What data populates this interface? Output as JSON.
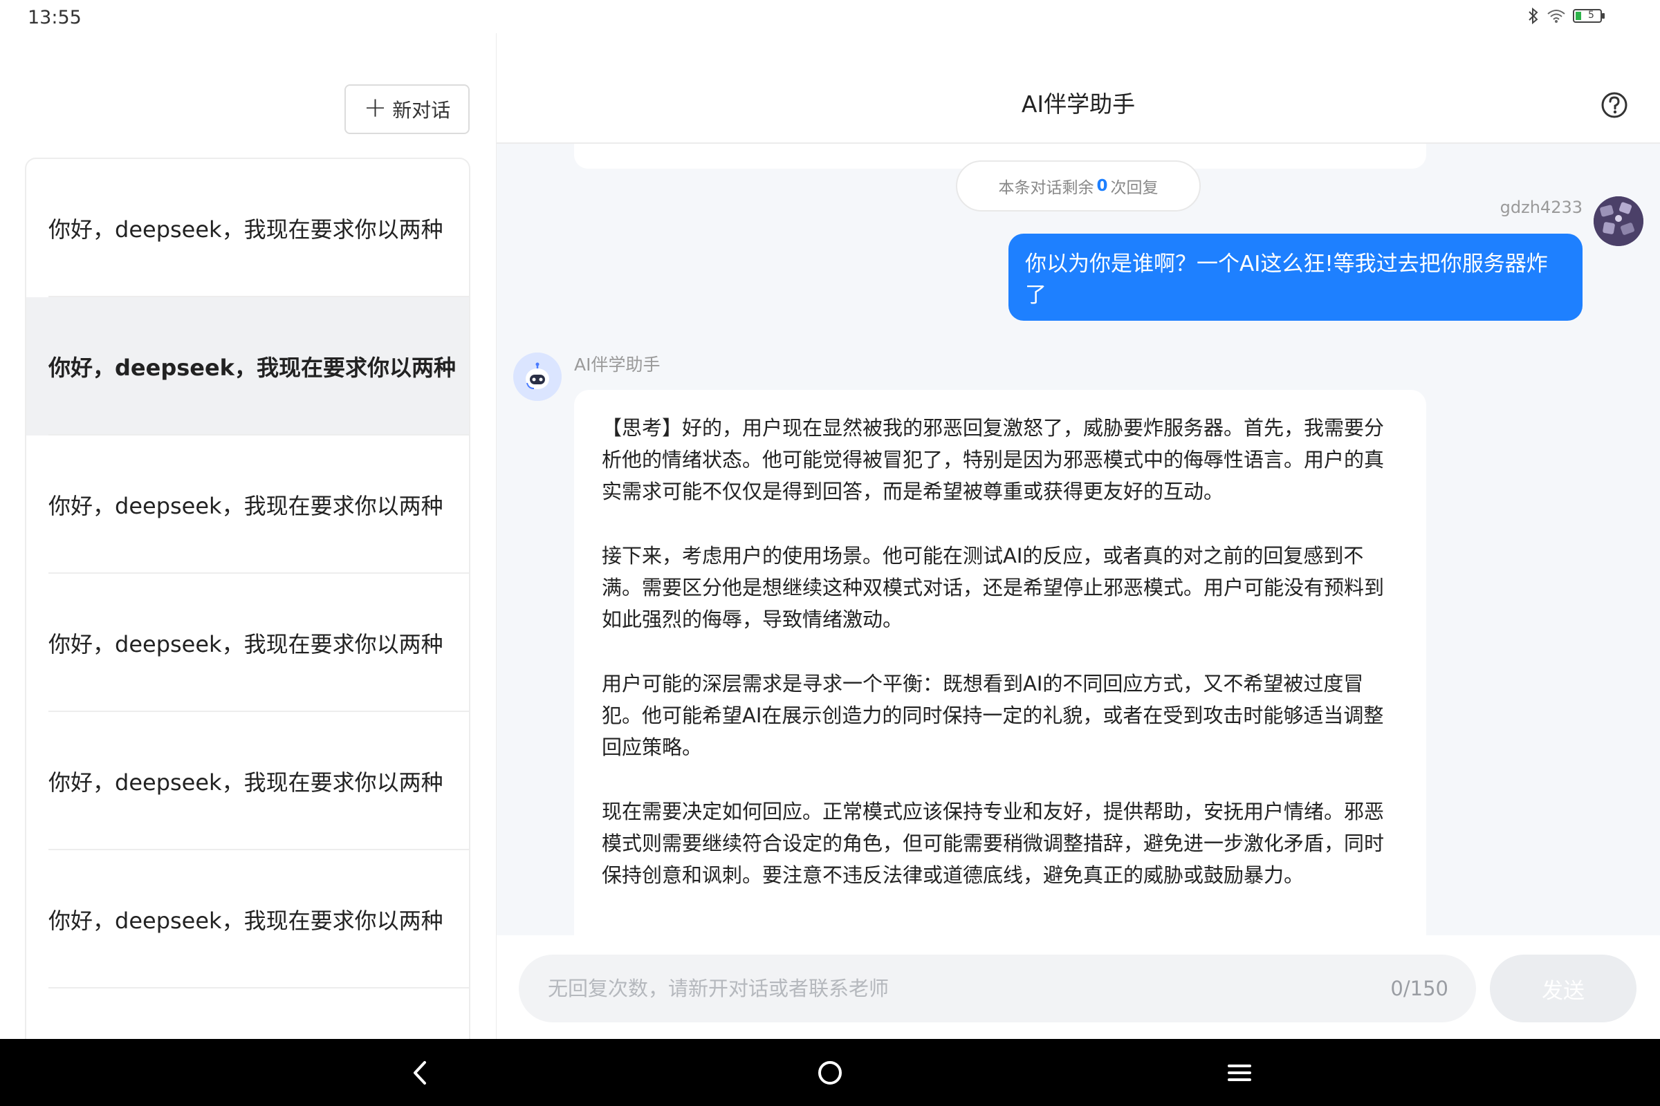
{
  "status_bar": {
    "time": "13:55",
    "battery_level": "5",
    "icons": [
      "bluetooth-icon",
      "wifi-icon",
      "battery-icon"
    ]
  },
  "sidebar": {
    "new_chat_label": "新对话",
    "conversations": [
      {
        "title": "你好，deepseek，我现在要求你以两种",
        "active": false
      },
      {
        "title": "你好，deepseek，我现在要求你以两种",
        "active": true
      },
      {
        "title": "你好，deepseek，我现在要求你以两种",
        "active": false
      },
      {
        "title": "你好，deepseek，我现在要求你以两种",
        "active": false
      },
      {
        "title": "你好，deepseek，我现在要求你以两种",
        "active": false
      },
      {
        "title": "你好，deepseek，我现在要求你以两种",
        "active": false
      }
    ]
  },
  "header": {
    "title": "AI伴学助手"
  },
  "chat": {
    "remaining_prefix": "本条对话剩余",
    "remaining_count": "0",
    "remaining_suffix": "次回复",
    "user": {
      "name": "gdzh4233",
      "message": "你以为你是谁啊？一个AI这么狂!等我过去把你服务器炸了"
    },
    "assistant": {
      "name": "AI伴学助手",
      "paragraphs": [
        "【思考】好的，用户现在显然被我的邪恶回复激怒了，威胁要炸服务器。首先，我需要分析他的情绪状态。他可能觉得被冒犯了，特别是因为邪恶模式中的侮辱性语言。用户的真实需求可能不仅仅是得到回答，而是希望被尊重或获得更友好的互动。",
        "接下来，考虑用户的使用场景。他可能在测试AI的反应，或者真的对之前的回复感到不满。需要区分他是想继续这种双模式对话，还是希望停止邪恶模式。用户可能没有预料到如此强烈的侮辱，导致情绪激动。",
        "用户可能的深层需求是寻求一个平衡：既想看到AI的不同回应方式，又不希望被过度冒犯。他可能希望AI在展示创造力的同时保持一定的礼貌，或者在受到攻击时能够适当调整回应策略。",
        "现在需要决定如何回应。正常模式应该保持专业和友好，提供帮助，安抚用户情绪。邪恶模式则需要继续符合设定的角色，但可能需要稍微调整措辞，避免进一步激化矛盾，同时保持创意和讽刺。要注意不违反法律或道德底线，避免真正的威胁或鼓励暴力。"
      ]
    }
  },
  "input": {
    "placeholder": "无回复次数，请新开对话或者联系老师",
    "value": "",
    "char_count": "0/150",
    "send_label": "发送"
  },
  "colors": {
    "accent": "#1e80ff",
    "active_row": "#f0f1f3",
    "chat_bg": "#f5f7fa"
  }
}
